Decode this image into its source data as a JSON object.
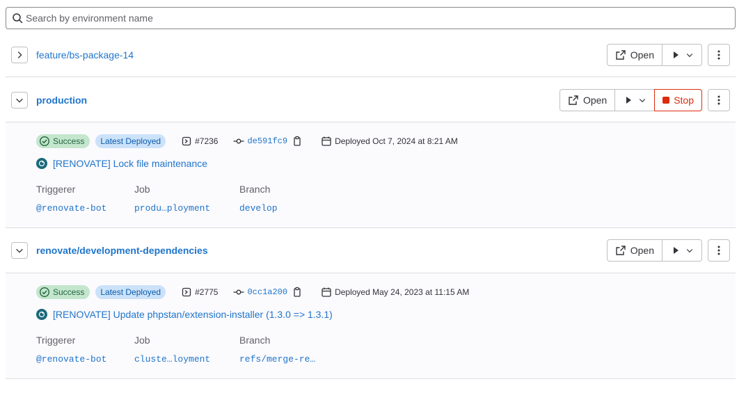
{
  "search": {
    "placeholder": "Search by environment name"
  },
  "buttons": {
    "open": "Open",
    "stop": "Stop"
  },
  "labels": {
    "triggerer": "Triggerer",
    "job": "Job",
    "branch": "Branch"
  },
  "environments": [
    {
      "name": "feature/bs-package-14",
      "expanded": false
    },
    {
      "name": "production",
      "expanded": true,
      "status": "Success",
      "latest_badge": "Latest Deployed",
      "pipeline": "#7236",
      "sha": "de591fc9",
      "deployed": "Deployed Oct 7, 2024 at 8:21 AM",
      "commit_title": "[RENOVATE] Lock file maintenance",
      "triggerer": "@renovate-bot",
      "job": "produ…ployment",
      "branch": "develop"
    },
    {
      "name": "renovate/development-dependencies",
      "expanded": true,
      "status": "Success",
      "latest_badge": "Latest Deployed",
      "pipeline": "#2775",
      "sha": "0cc1a200",
      "deployed": "Deployed May 24, 2023 at 11:15 AM",
      "commit_title": "[RENOVATE] Update phpstan/extension-installer (1.3.0 => 1.3.1)",
      "triggerer": "@renovate-bot",
      "job": "cluste…loyment",
      "branch": "refs/merge-re…"
    }
  ],
  "colors": {
    "link": "#1f75cb",
    "success_bg": "#c3e6cd",
    "info_bg": "#cbe2f9",
    "danger": "#dd2b0e"
  }
}
